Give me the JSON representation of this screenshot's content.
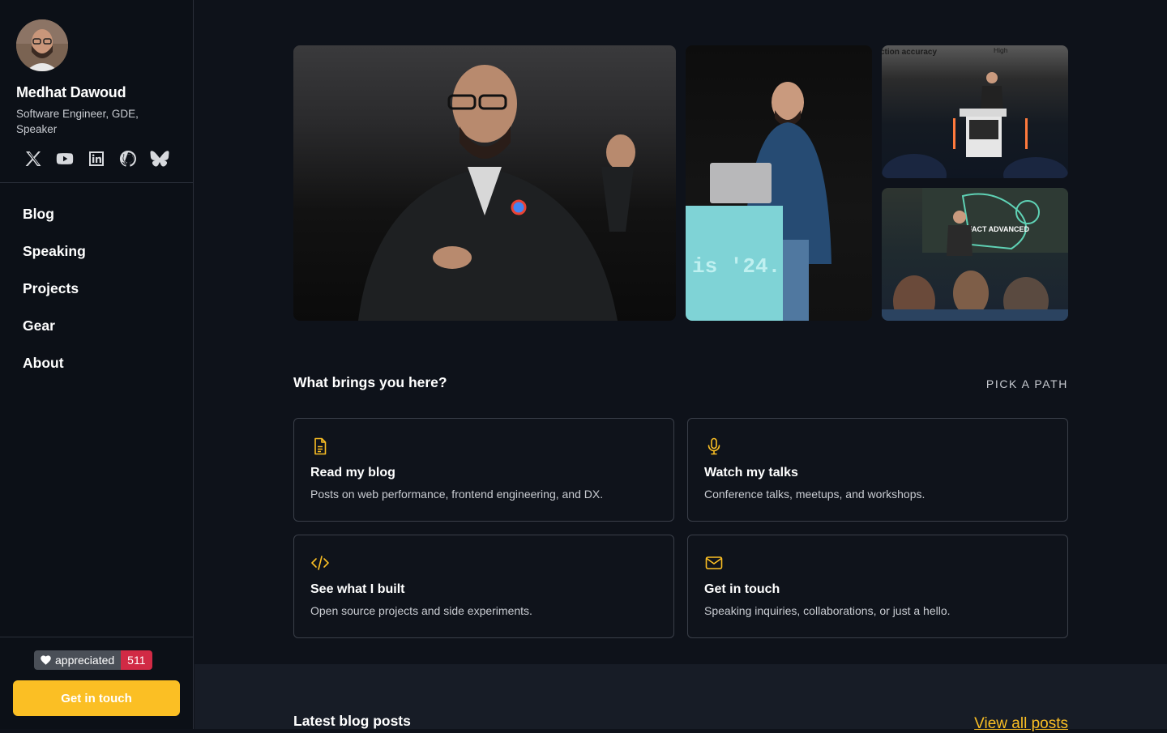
{
  "profile": {
    "name": "Medhat Dawoud",
    "role": "Software Engineer, GDE, Speaker",
    "socials": [
      "x-icon",
      "youtube-icon",
      "linkedin-icon",
      "github-icon",
      "bluesky-icon"
    ]
  },
  "nav": {
    "items": [
      {
        "label": "Blog"
      },
      {
        "label": "Speaking"
      },
      {
        "label": "Projects"
      },
      {
        "label": "Gear"
      },
      {
        "label": "About"
      }
    ]
  },
  "footer": {
    "badge_label": "appreciated",
    "badge_count": "511",
    "cta_label": "Get in touch"
  },
  "photos": {
    "slide_text_1": "ction accuracy",
    "slide_text_2": "High",
    "podium_text": "is '24.",
    "screen_text": "FACT ADVANCED"
  },
  "intro": {
    "title": "What brings you here?",
    "tag": "PICK A PATH"
  },
  "cards": [
    {
      "icon": "document-icon",
      "title": "Read my blog",
      "desc": "Posts on web performance, frontend engineering, and DX."
    },
    {
      "icon": "microphone-icon",
      "title": "Watch my talks",
      "desc": "Conference talks, meetups, and workshops."
    },
    {
      "icon": "code-icon",
      "title": "See what I built",
      "desc": "Open source projects and side experiments."
    },
    {
      "icon": "mail-icon",
      "title": "Get in touch",
      "desc": "Speaking inquiries, collaborations, or just a hello."
    }
  ],
  "latest": {
    "title": "Latest blog posts",
    "view_all": "View all posts"
  },
  "colors": {
    "accent": "#fbbf24",
    "badge_count_bg": "#d12a45",
    "background": "#0e121a"
  }
}
